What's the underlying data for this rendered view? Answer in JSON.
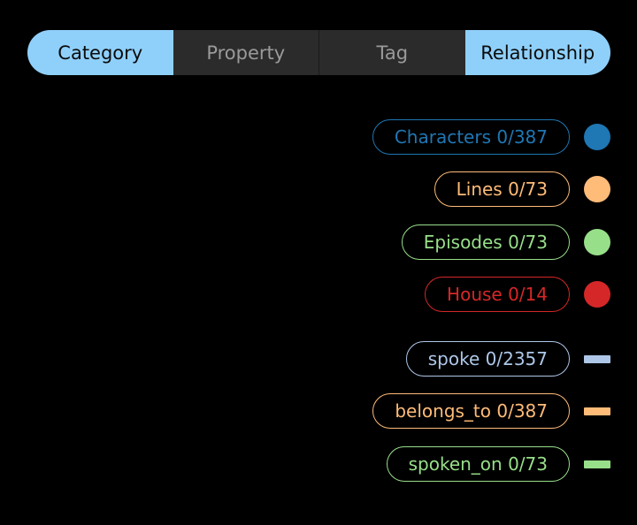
{
  "tabs": [
    {
      "label": "Category",
      "active": true
    },
    {
      "label": "Property",
      "active": false
    },
    {
      "label": "Tag",
      "active": false
    },
    {
      "label": "Relationship",
      "active": true
    }
  ],
  "legend": {
    "categories": [
      {
        "label": "Characters 0/387",
        "color": "#1f77b4",
        "marker": "circle"
      },
      {
        "label": "Lines 0/73",
        "color": "#ffbb78",
        "marker": "circle"
      },
      {
        "label": "Episodes 0/73",
        "color": "#98df8a",
        "marker": "circle"
      },
      {
        "label": "House 0/14",
        "color": "#d62728",
        "marker": "circle"
      }
    ],
    "relationships": [
      {
        "label": "spoke 0/2357",
        "color": "#aec7e8",
        "marker": "line"
      },
      {
        "label": "belongs_to 0/387",
        "color": "#ffbb78",
        "marker": "line"
      },
      {
        "label": "spoken_on 0/73",
        "color": "#98df8a",
        "marker": "line"
      }
    ]
  }
}
